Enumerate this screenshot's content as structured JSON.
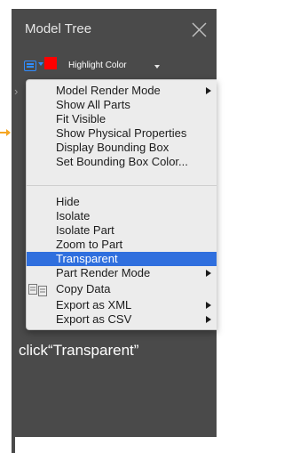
{
  "panel": {
    "title": "Model Tree",
    "close_icon": "close-icon"
  },
  "toolbar": {
    "tree_icon": "model-tree-icon",
    "highlight_color_label": "Highlight Color",
    "highlight_color": "#ff0000"
  },
  "menu": {
    "items": [
      {
        "label": "Model Render Mode",
        "has_submenu": true
      },
      {
        "label": "Show All Parts",
        "has_submenu": false
      },
      {
        "label": "Fit Visible",
        "has_submenu": false
      },
      {
        "label": "Show Physical Properties",
        "has_submenu": false
      },
      {
        "label": "Display Bounding Box",
        "has_submenu": false
      },
      {
        "label": "Set Bounding Box Color...",
        "has_submenu": false
      },
      {
        "label": "Hide",
        "has_submenu": false
      },
      {
        "label": "Isolate",
        "has_submenu": false
      },
      {
        "label": "Isolate Part",
        "has_submenu": false
      },
      {
        "label": "Zoom to Part",
        "has_submenu": false
      },
      {
        "label": "Transparent",
        "has_submenu": false,
        "selected": true
      },
      {
        "label": "Part Render Mode",
        "has_submenu": true
      },
      {
        "label": "Copy Data",
        "has_submenu": false,
        "icon": "copy-data-icon"
      },
      {
        "label": "Export as XML",
        "has_submenu": true
      },
      {
        "label": "Export as CSV",
        "has_submenu": true
      }
    ],
    "selected_color": "#2f6fde"
  },
  "annotation": {
    "instruction": "click“Transparent”",
    "pointer_color": "#f5a623"
  }
}
